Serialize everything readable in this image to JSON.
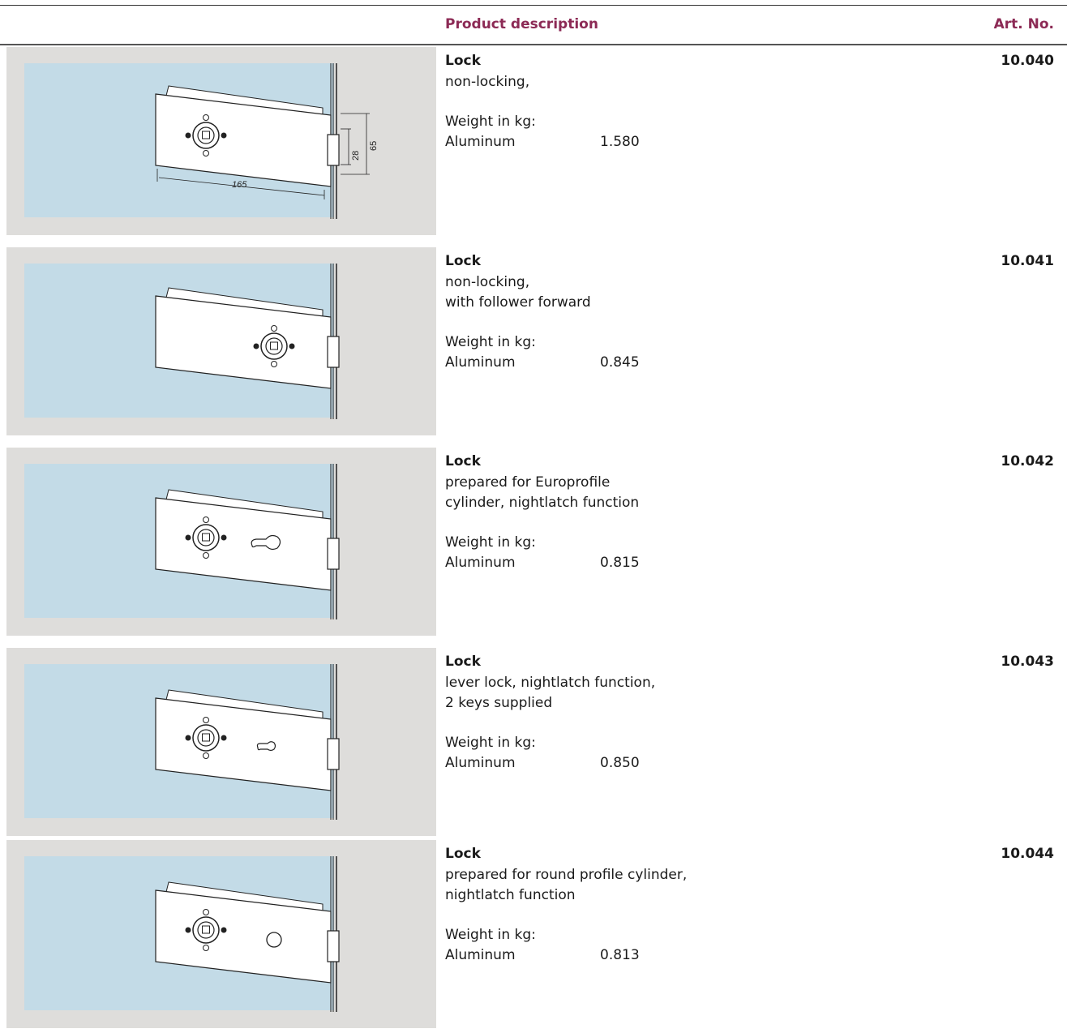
{
  "header": {
    "description_label": "Product description",
    "art_no_label": "Art. No."
  },
  "products": [
    {
      "name": "Lock",
      "description": "non-locking,",
      "weight_label": "Weight in kg:",
      "material": "Aluminum",
      "weight": "1.580",
      "art_no": "10.040",
      "dimensions": {
        "width": "165",
        "strike": "28",
        "height": "65"
      }
    },
    {
      "name": "Lock",
      "description": "non-locking,\nwith follower forward",
      "weight_label": "Weight in kg:",
      "material": "Aluminum",
      "weight": "0.845",
      "art_no": "10.041"
    },
    {
      "name": "Lock",
      "description": "prepared for Europrofile\ncylinder, nightlatch function",
      "weight_label": "Weight in kg:",
      "material": "Aluminum",
      "weight": "0.815",
      "art_no": "10.042"
    },
    {
      "name": "Lock",
      "description": "lever lock, nightlatch function,\n2 keys supplied",
      "weight_label": "Weight in kg:",
      "material": "Aluminum",
      "weight": "0.850",
      "art_no": "10.043"
    },
    {
      "name": "Lock",
      "description": "prepared for round profile cylinder,\nnightlatch function",
      "weight_label": "Weight in kg:",
      "material": "Aluminum",
      "weight": "0.813",
      "art_no": "10.044"
    }
  ],
  "colors": {
    "accent": "#8c2a55",
    "image_background": "#dedddb",
    "glass": "#c3dbe7"
  }
}
